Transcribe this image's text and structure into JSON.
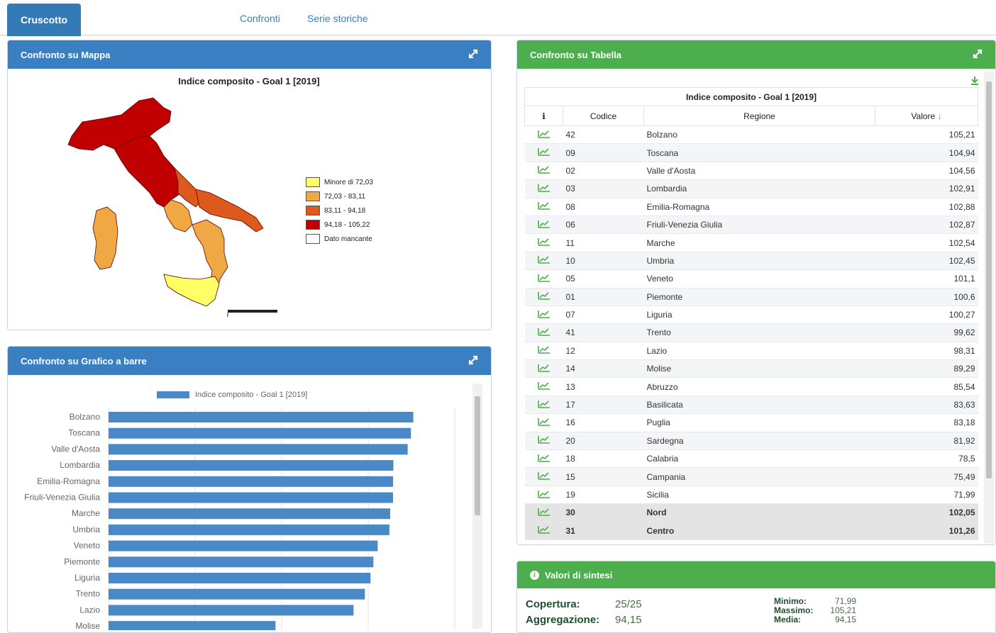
{
  "tabs": [
    {
      "label": "Cruscotto",
      "active": true
    },
    {
      "label": "Confronti",
      "active": false
    },
    {
      "label": "Serie storiche",
      "active": false
    }
  ],
  "map_panel": {
    "title": "Confronto su Mappa",
    "chart_title": "Indice composito - Goal 1 [2019]",
    "legend": [
      {
        "label": "Minore di 72,03",
        "color": "#ffff66"
      },
      {
        "label": "72,03 - 83,11",
        "color": "#f0a844"
      },
      {
        "label": "83,11 - 94,18",
        "color": "#de5a1c"
      },
      {
        "label": "94,18 - 105,22",
        "color": "#c00000"
      },
      {
        "label": "Dato mancante",
        "color": "#ffffff"
      }
    ]
  },
  "table_panel": {
    "title": "Confronto su Tabella",
    "table_title": "Indice composito - Goal 1 [2019]",
    "headers": {
      "info": "ℹ",
      "code": "Codice",
      "region": "Regione",
      "value": "Valore"
    },
    "rows": [
      {
        "code": "42",
        "region": "Bolzano",
        "value": "105,21"
      },
      {
        "code": "09",
        "region": "Toscana",
        "value": "104,94"
      },
      {
        "code": "02",
        "region": "Valle d'Aosta",
        "value": "104,56"
      },
      {
        "code": "03",
        "region": "Lombardia",
        "value": "102,91"
      },
      {
        "code": "08",
        "region": "Emilia-Romagna",
        "value": "102,88"
      },
      {
        "code": "06",
        "region": "Friuli-Venezia Giulia",
        "value": "102,87"
      },
      {
        "code": "11",
        "region": "Marche",
        "value": "102,54"
      },
      {
        "code": "10",
        "region": "Umbria",
        "value": "102,45"
      },
      {
        "code": "05",
        "region": "Veneto",
        "value": "101,1"
      },
      {
        "code": "01",
        "region": "Piemonte",
        "value": "100,6"
      },
      {
        "code": "07",
        "region": "Liguria",
        "value": "100,27"
      },
      {
        "code": "41",
        "region": "Trento",
        "value": "99,62"
      },
      {
        "code": "12",
        "region": "Lazio",
        "value": "98,31"
      },
      {
        "code": "14",
        "region": "Molise",
        "value": "89,29"
      },
      {
        "code": "13",
        "region": "Abruzzo",
        "value": "85,54"
      },
      {
        "code": "17",
        "region": "Basilicata",
        "value": "83,63"
      },
      {
        "code": "16",
        "region": "Puglia",
        "value": "83,18"
      },
      {
        "code": "20",
        "region": "Sardegna",
        "value": "81,92"
      },
      {
        "code": "18",
        "region": "Calabria",
        "value": "78,5"
      },
      {
        "code": "15",
        "region": "Campania",
        "value": "75,49"
      },
      {
        "code": "19",
        "region": "Sicilia",
        "value": "71,99"
      },
      {
        "code": "30",
        "region": "Nord",
        "value": "102,05",
        "aggregate": true
      },
      {
        "code": "31",
        "region": "Centro",
        "value": "101,26",
        "aggregate": true
      }
    ]
  },
  "bar_panel": {
    "title": "Confronto su Grafico a barre"
  },
  "chart_data": {
    "type": "bar",
    "orientation": "horizontal",
    "series": [
      {
        "name": "Indice composito - Goal 1 [2019]",
        "color": "#4a89c7"
      }
    ],
    "categories": [
      "Bolzano",
      "Toscana",
      "Valle d'Aosta",
      "Lombardia",
      "Emilia-Romagna",
      "Friuli-Venezia Giulia",
      "Marche",
      "Umbria",
      "Veneto",
      "Piemonte",
      "Liguria",
      "Trento",
      "Lazio",
      "Molise"
    ],
    "values": [
      105.21,
      104.94,
      104.56,
      102.91,
      102.88,
      102.87,
      102.54,
      102.45,
      101.1,
      100.6,
      100.27,
      99.62,
      98.31,
      89.29
    ],
    "xlim": [
      70,
      110
    ],
    "grid": true
  },
  "summary_panel": {
    "title": "Valori di sintesi",
    "coverage_label": "Copertura:",
    "coverage_value": "25/25",
    "aggregation_label": "Aggregazione:",
    "aggregation_value": "94,15",
    "min_label": "Minimo:",
    "min_value": "71,99",
    "max_label": "Massimo:",
    "max_value": "105,21",
    "mean_label": "Media:",
    "mean_value": "94,15"
  },
  "colors": {
    "primary": "#3a7fc1",
    "success": "#4cae4c",
    "bar": "#4a89c7"
  }
}
